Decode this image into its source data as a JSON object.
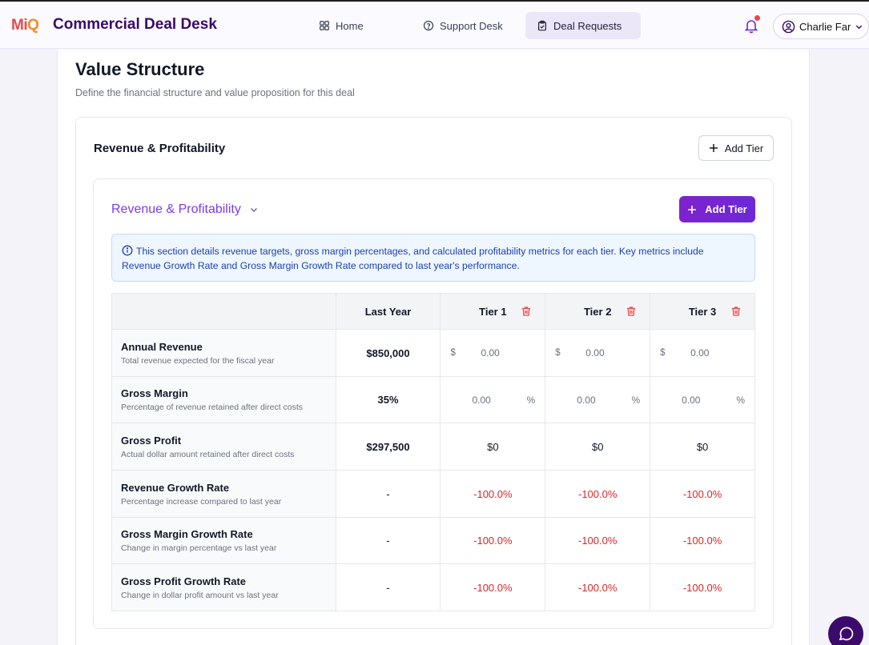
{
  "header": {
    "logo_m": "Mi",
    "logo_q": "Q",
    "app_title": "Commercial Deal Desk",
    "nav": [
      {
        "label": "Home",
        "icon": "grid-icon"
      },
      {
        "label": "Support Desk",
        "icon": "help-circle-icon"
      },
      {
        "label": "Deal Requests",
        "icon": "clipboard-icon",
        "active": true
      }
    ],
    "user_name": "Charlie Far"
  },
  "page": {
    "title": "Value Structure",
    "subtitle": "Define the financial structure and value proposition for this deal"
  },
  "section": {
    "title": "Revenue & Profitability",
    "add_tier_label": "Add Tier",
    "inner_title": "Revenue & Profitability",
    "inner_add_tier_label": "Add Tier",
    "info_text": "This section details revenue targets, gross margin percentages, and calculated profitability metrics for each tier. Key metrics include Revenue Growth Rate and Gross Margin Growth Rate compared to last year's performance."
  },
  "table": {
    "columns": [
      "Last Year",
      "Tier 1",
      "Tier 2",
      "Tier 3"
    ],
    "rows": [
      {
        "title": "Annual Revenue",
        "desc": "Total revenue expected for the fiscal year",
        "last_year": "$850,000",
        "type": "currency",
        "tiers": [
          "0.00",
          "0.00",
          "0.00"
        ],
        "currency": "$"
      },
      {
        "title": "Gross Margin",
        "desc": "Percentage of revenue retained after direct costs",
        "last_year": "35%",
        "type": "percent",
        "tiers": [
          "0.00",
          "0.00",
          "0.00"
        ],
        "unit": "%"
      },
      {
        "title": "Gross Profit",
        "desc": "Actual dollar amount retained after direct costs",
        "last_year": "$297,500",
        "type": "text",
        "tiers": [
          "$0",
          "$0",
          "$0"
        ]
      },
      {
        "title": "Revenue Growth Rate",
        "desc": "Percentage increase compared to last year",
        "last_year": "-",
        "type": "neg",
        "tiers": [
          "-100.0%",
          "-100.0%",
          "-100.0%"
        ]
      },
      {
        "title": "Gross Margin Growth Rate",
        "desc": "Change in margin percentage vs last year",
        "last_year": "-",
        "type": "neg",
        "tiers": [
          "-100.0%",
          "-100.0%",
          "-100.0%"
        ]
      },
      {
        "title": "Gross Profit Growth Rate",
        "desc": "Change in dollar profit amount vs last year",
        "last_year": "-",
        "type": "neg",
        "tiers": [
          "-100.0%",
          "-100.0%",
          "-100.0%"
        ]
      }
    ]
  },
  "colors": {
    "brand": "#3b0a6b",
    "accent": "#7c3aed",
    "negative": "#dc2626"
  }
}
